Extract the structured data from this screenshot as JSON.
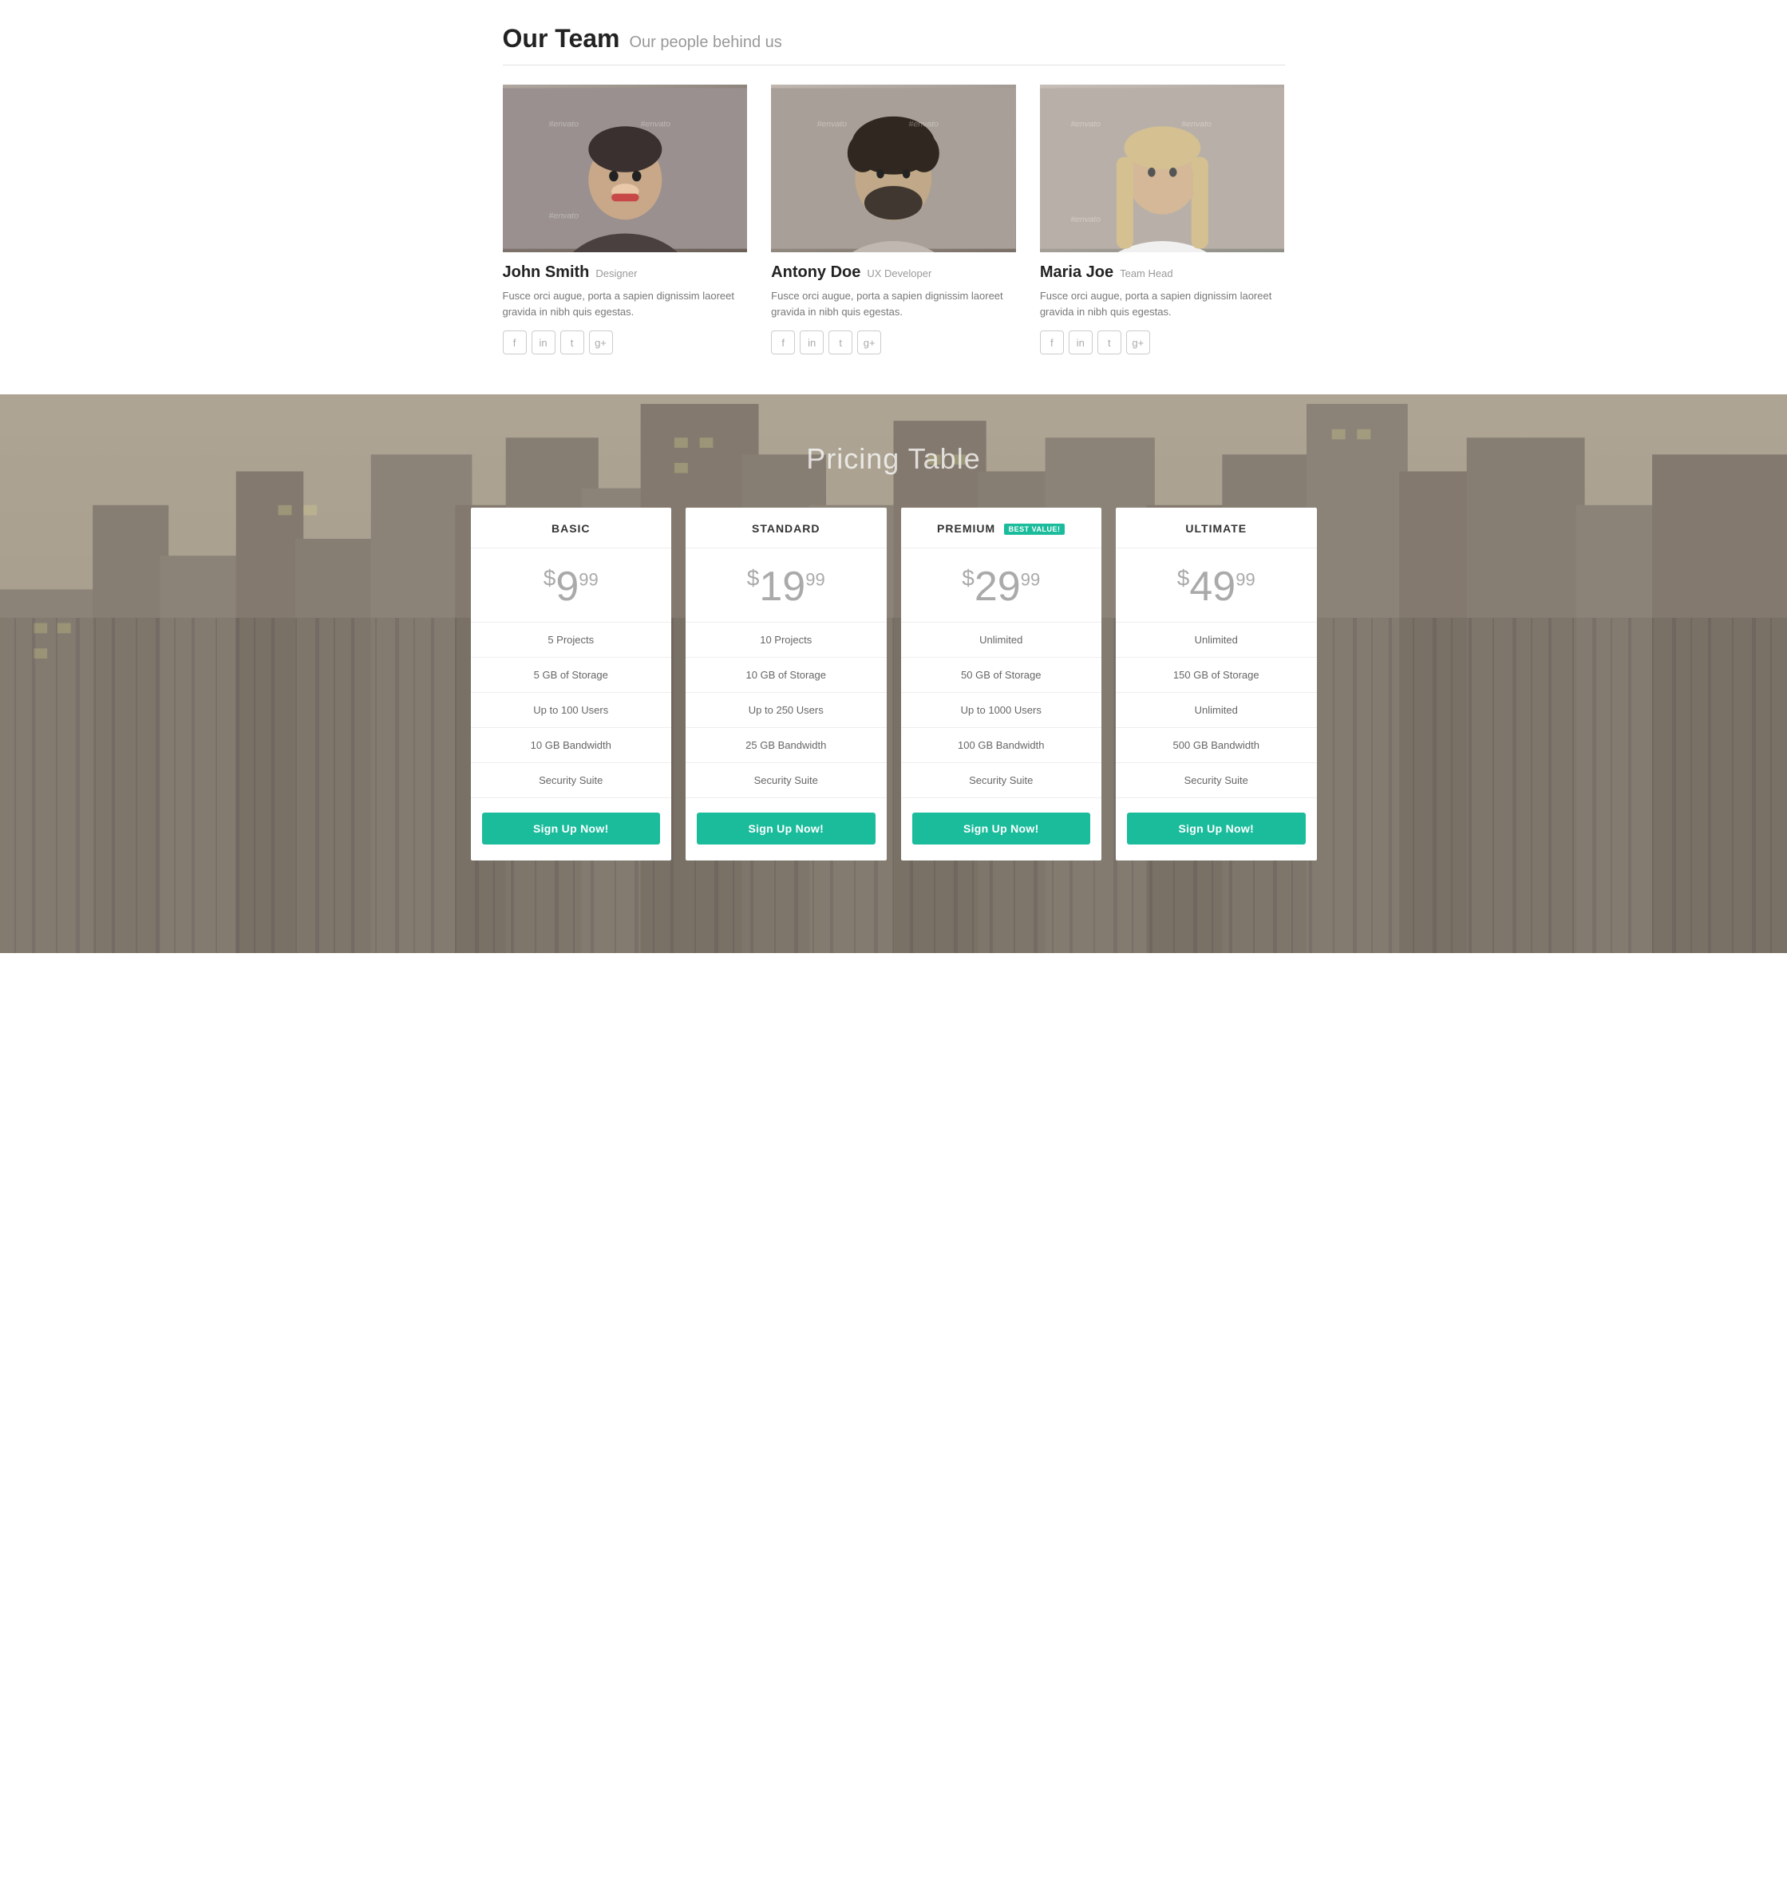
{
  "team": {
    "section_title": "Our Team",
    "section_subtitle": "Our people behind us",
    "members": [
      {
        "name": "John Smith",
        "role": "Designer",
        "bio": "Fusce orci augue, porta a sapien dignissim laoreet gravida in nibh quis egestas.",
        "photo_class": "photo-john",
        "photo_alt": "John Smith photo"
      },
      {
        "name": "Antony Doe",
        "role": "UX Developer",
        "bio": "Fusce orci augue, porta a sapien dignissim laoreet gravida in nibh quis egestas.",
        "photo_class": "photo-antony",
        "photo_alt": "Antony Doe photo"
      },
      {
        "name": "Maria Joe",
        "role": "Team Head",
        "bio": "Fusce orci augue, porta a sapien dignissim laoreet gravida in nibh quis egestas.",
        "photo_class": "photo-maria",
        "photo_alt": "Maria Joe photo"
      }
    ],
    "social_icons": [
      "f",
      "in",
      "t",
      "g+"
    ]
  },
  "pricing": {
    "section_title": "Pricing Table",
    "plans": [
      {
        "tier": "BASIC",
        "price_main": "9",
        "price_cents": "99",
        "best_value": false,
        "features": [
          "5 Projects",
          "5 GB of Storage",
          "Up to 100 Users",
          "10 GB Bandwidth",
          "Security Suite"
        ],
        "cta": "Sign Up Now!"
      },
      {
        "tier": "STANDARD",
        "price_main": "19",
        "price_cents": "99",
        "best_value": false,
        "features": [
          "10 Projects",
          "10 GB of Storage",
          "Up to 250 Users",
          "25 GB Bandwidth",
          "Security Suite"
        ],
        "cta": "Sign Up Now!"
      },
      {
        "tier": "PREMIUM",
        "price_main": "29",
        "price_cents": "99",
        "best_value": true,
        "best_value_label": "BEST VALUE!",
        "features": [
          "Unlimited",
          "50 GB of Storage",
          "Up to 1000 Users",
          "100 GB Bandwidth",
          "Security Suite"
        ],
        "cta": "Sign Up Now!"
      },
      {
        "tier": "ULTIMATE",
        "price_main": "49",
        "price_cents": "99",
        "best_value": false,
        "features": [
          "Unlimited",
          "150 GB of Storage",
          "Unlimited",
          "500 GB Bandwidth",
          "Security Suite"
        ],
        "cta": "Sign Up Now!"
      }
    ]
  }
}
